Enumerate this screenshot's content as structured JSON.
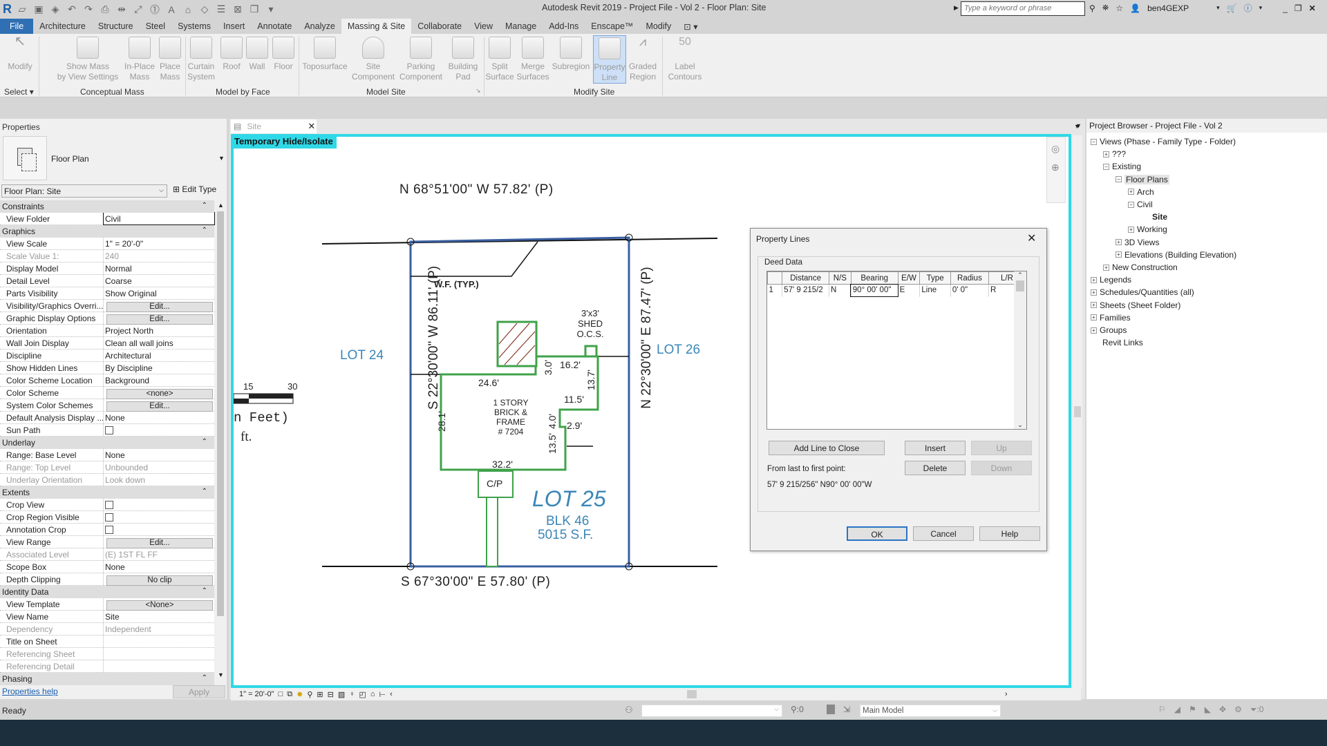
{
  "app": {
    "title": "Autodesk Revit 2019 - Project File - Vol 2 - Floor Plan: Site",
    "search_placeholder": "Type a keyword or phrase",
    "user": "ben4GEXP"
  },
  "ribbon_tabs": [
    "File",
    "Architecture",
    "Structure",
    "Steel",
    "Systems",
    "Insert",
    "Annotate",
    "Analyze",
    "Massing & Site",
    "Collaborate",
    "View",
    "Manage",
    "Add-Ins",
    "Enscape™",
    "Modify"
  ],
  "active_tab": "Massing & Site",
  "ribbon": {
    "select_label": "Select",
    "buttons": [
      {
        "label": "Modify",
        "sub": ""
      },
      {
        "label": "Show Mass",
        "sub": "by View Settings"
      },
      {
        "label": "In-Place",
        "sub": "Mass"
      },
      {
        "label": "Place",
        "sub": "Mass"
      },
      {
        "label": "Curtain",
        "sub": "System"
      },
      {
        "label": "Roof",
        "sub": ""
      },
      {
        "label": "Wall",
        "sub": ""
      },
      {
        "label": "Floor",
        "sub": ""
      },
      {
        "label": "Toposurface",
        "sub": ""
      },
      {
        "label": "Site",
        "sub": "Component"
      },
      {
        "label": "Parking",
        "sub": "Component"
      },
      {
        "label": "Building",
        "sub": "Pad"
      },
      {
        "label": "Split",
        "sub": "Surface"
      },
      {
        "label": "Merge",
        "sub": "Surfaces"
      },
      {
        "label": "Subregion",
        "sub": ""
      },
      {
        "label": "Property",
        "sub": "Line"
      },
      {
        "label": "Graded",
        "sub": "Region"
      },
      {
        "label": "Label",
        "sub": "Contours"
      }
    ],
    "panels": [
      "Conceptual Mass",
      "Model by Face",
      "Model Site",
      "Modify Site"
    ]
  },
  "properties": {
    "title": "Properties",
    "type_name": "Floor Plan",
    "instance_selector": "Floor Plan: Site",
    "edit_type": "Edit Type",
    "groups": [
      {
        "name": "Constraints",
        "rows": [
          {
            "k": "View Folder",
            "v": "Civil"
          }
        ]
      },
      {
        "name": "Graphics",
        "rows": [
          {
            "k": "View Scale",
            "v": "1\" = 20'-0\""
          },
          {
            "k": "Scale Value    1:",
            "v": "240",
            "dim": true
          },
          {
            "k": "Display Model",
            "v": "Normal"
          },
          {
            "k": "Detail Level",
            "v": "Coarse"
          },
          {
            "k": "Parts Visibility",
            "v": "Show Original"
          },
          {
            "k": "Visibility/Graphics Overri...",
            "v": "Edit...",
            "btn": true
          },
          {
            "k": "Graphic Display Options",
            "v": "Edit...",
            "btn": true
          },
          {
            "k": "Orientation",
            "v": "Project North"
          },
          {
            "k": "Wall Join Display",
            "v": "Clean all wall joins"
          },
          {
            "k": "Discipline",
            "v": "Architectural"
          },
          {
            "k": "Show Hidden Lines",
            "v": "By Discipline"
          },
          {
            "k": "Color Scheme Location",
            "v": "Background"
          },
          {
            "k": "Color Scheme",
            "v": "<none>",
            "btn": true
          },
          {
            "k": "System Color Schemes",
            "v": "Edit...",
            "btn": true
          },
          {
            "k": "Default Analysis Display ...",
            "v": "None"
          },
          {
            "k": "Sun Path",
            "v": "",
            "cb": true
          }
        ]
      },
      {
        "name": "Underlay",
        "rows": [
          {
            "k": "Range: Base Level",
            "v": "None"
          },
          {
            "k": "Range: Top Level",
            "v": "Unbounded",
            "dim": true
          },
          {
            "k": "Underlay Orientation",
            "v": "Look down",
            "dim": true
          }
        ]
      },
      {
        "name": "Extents",
        "rows": [
          {
            "k": "Crop View",
            "v": "",
            "cb": true
          },
          {
            "k": "Crop Region Visible",
            "v": "",
            "cb": true
          },
          {
            "k": "Annotation Crop",
            "v": "",
            "cb": true
          },
          {
            "k": "View Range",
            "v": "Edit...",
            "btn": true
          },
          {
            "k": "Associated Level",
            "v": "(E) 1ST FL FF",
            "dim": true
          },
          {
            "k": "Scope Box",
            "v": "None"
          },
          {
            "k": "Depth Clipping",
            "v": "No clip",
            "btn": true
          }
        ]
      },
      {
        "name": "Identity Data",
        "rows": [
          {
            "k": "View Template",
            "v": "<None>",
            "btn": true
          },
          {
            "k": "View Name",
            "v": "Site"
          },
          {
            "k": "Dependency",
            "v": "Independent",
            "dim": true
          },
          {
            "k": "Title on Sheet",
            "v": ""
          },
          {
            "k": "Referencing Sheet",
            "v": "",
            "dim": true
          },
          {
            "k": "Referencing Detail",
            "v": "",
            "dim": true
          }
        ]
      },
      {
        "name": "Phasing",
        "rows": []
      }
    ],
    "help_link": "Properties help",
    "apply": "Apply"
  },
  "view": {
    "tab_label": "Site",
    "temp_hide": "Temporary Hide/Isolate",
    "scale": "1\" = 20'-0\"",
    "drawing": {
      "north_line": "N 68°51'00\" W 57.82' (P)",
      "south_line": "S 67°30'00\" E 57.80' (P)",
      "west_line": "S 22°30'00\" W 86.11' (P)",
      "east_line": "N 22°30'00\" E 87.47' (P)",
      "wf": "W.F. (TYP.)",
      "lot24": "LOT 24",
      "lot26": "LOT 26",
      "lot25": "LOT 25",
      "blk": "BLK 46",
      "area": "5015 S.F.",
      "house1": "1 STORY",
      "house2": "BRICK & FRAME",
      "house3": "# 7204",
      "shed1": "3'x3'",
      "shed2": "SHED",
      "shed3": "O.C.S.",
      "cp": "C/P",
      "dims": {
        "d1": "24.6'",
        "d2": "3.0'",
        "d3": "16.2'",
        "d4": "13.7'",
        "d5": "11.5'",
        "d6": "4.0'",
        "d7": "2.9'",
        "d8": "13.5'",
        "d9": "32.2'",
        "d10": "28.1'"
      },
      "scale15": "15",
      "scale30": "30",
      "in_feet": "n Feet)",
      "ft": "ft."
    }
  },
  "browser": {
    "title": "Project Browser - Project File - Vol 2",
    "nodes": [
      {
        "label": "Views (Phase - Family Type - Folder)",
        "level": 0,
        "pm": "-"
      },
      {
        "label": "???",
        "level": 1,
        "pm": "+"
      },
      {
        "label": "Existing",
        "level": 1,
        "pm": "-"
      },
      {
        "label": "Floor Plans",
        "level": 2,
        "pm": "-",
        "hl": true
      },
      {
        "label": "Arch",
        "level": 3,
        "pm": "+"
      },
      {
        "label": "Civil",
        "level": 3,
        "pm": "-"
      },
      {
        "label": "Site",
        "level": 4,
        "pm": "",
        "bold": true
      },
      {
        "label": "Working",
        "level": 3,
        "pm": "+"
      },
      {
        "label": "3D Views",
        "level": 2,
        "pm": "+"
      },
      {
        "label": "Elevations (Building Elevation)",
        "level": 2,
        "pm": "+"
      },
      {
        "label": "New Construction",
        "level": 1,
        "pm": "+"
      },
      {
        "label": "Legends",
        "level": 0,
        "pm": "+"
      },
      {
        "label": "Schedules/Quantities (all)",
        "level": 0,
        "pm": "+"
      },
      {
        "label": "Sheets (Sheet Folder)",
        "level": 0,
        "pm": "+"
      },
      {
        "label": "Families",
        "level": 0,
        "pm": "+"
      },
      {
        "label": "Groups",
        "level": 0,
        "pm": "+"
      },
      {
        "label": "Revit Links",
        "level": 0,
        "pm": ""
      }
    ]
  },
  "dialog": {
    "title": "Property Lines",
    "group": "Deed Data",
    "columns": [
      "",
      "Distance",
      "N/S",
      "Bearing",
      "E/W",
      "Type",
      "Radius",
      "L/R"
    ],
    "rows": [
      [
        "1",
        "57'  9 215/2",
        "N",
        "90° 00' 00\"",
        "E",
        "Line",
        "0'  0\"",
        "R"
      ]
    ],
    "add_line": "Add Line to Close",
    "insert": "Insert",
    "up": "Up",
    "delete": "Delete",
    "down": "Down",
    "from_last": "From last to first point:",
    "closing": "57'  9 215/256\" N90° 00' 00\"W",
    "ok": "OK",
    "cancel": "Cancel",
    "help": "Help"
  },
  "status": {
    "ready": "Ready",
    "count1": ":0",
    "workset": "Main Model",
    "filter_count": ":0"
  }
}
